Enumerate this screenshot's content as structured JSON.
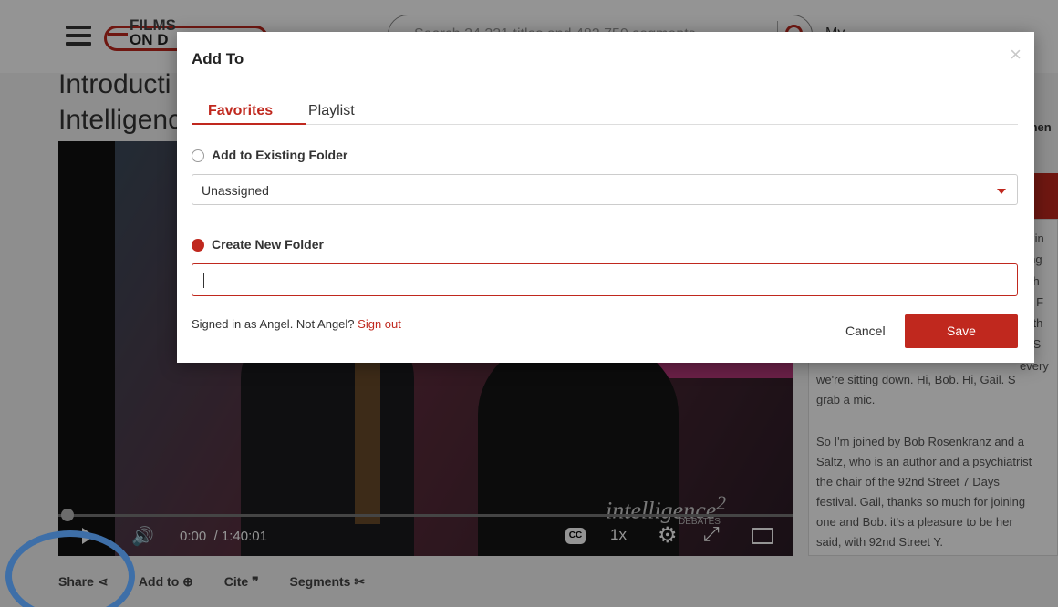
{
  "header": {
    "logo_line1": "FILMS",
    "logo_line2": "ON D",
    "search_placeholder": "Search 24,331 titles and 482,759 segments",
    "nav_partial": "My..."
  },
  "page": {
    "title_line1": "Introducti",
    "title_line2": "Intelligenc",
    "side_tab_partial": "men"
  },
  "video": {
    "logo_text": "intelligence",
    "logo_sup": "2",
    "logo_sub": "DEBATES",
    "time_current": "0:00",
    "time_total": "/ 1:40:01",
    "cc_label": "CC",
    "speed": "1x"
  },
  "transcript": {
    "clip_lines": [
      "alkin",
      "oing",
      "o th",
      "ob F",
      "ut th",
      "e. S",
      "every"
    ],
    "para1_lines": [
      "we're sitting down. Hi, Bob. Hi, Gail. S",
      "grab a mic."
    ],
    "para2_lines": [
      "So I'm joined by Bob Rosenkranz and a",
      "Saltz, who is an author and a psychiatrist",
      "the chair of the 92nd Street 7 Days",
      "festival. Gail, thanks so much for joining",
      "one and Bob. it's a pleasure to be her",
      "said, with 92nd Street Y."
    ]
  },
  "actions": {
    "share": "Share",
    "add_to": "Add to",
    "cite": "Cite",
    "segments": "Segments"
  },
  "modal": {
    "title": "Add To",
    "close": "×",
    "tabs": [
      {
        "label": "Favorites",
        "active": true
      },
      {
        "label": "Playlist",
        "active": false
      }
    ],
    "existing_folder_label": "Add to Existing Folder",
    "existing_folder_selected": false,
    "folder_select_value": "Unassigned",
    "create_folder_label": "Create New Folder",
    "create_folder_selected": true,
    "new_folder_value": "",
    "signed_in_text": "Signed in as Angel. Not Angel?",
    "sign_out": "Sign out",
    "cancel": "Cancel",
    "save": "Save"
  },
  "colors": {
    "accent": "#c0281e",
    "annotation": "#3e6fa8"
  }
}
